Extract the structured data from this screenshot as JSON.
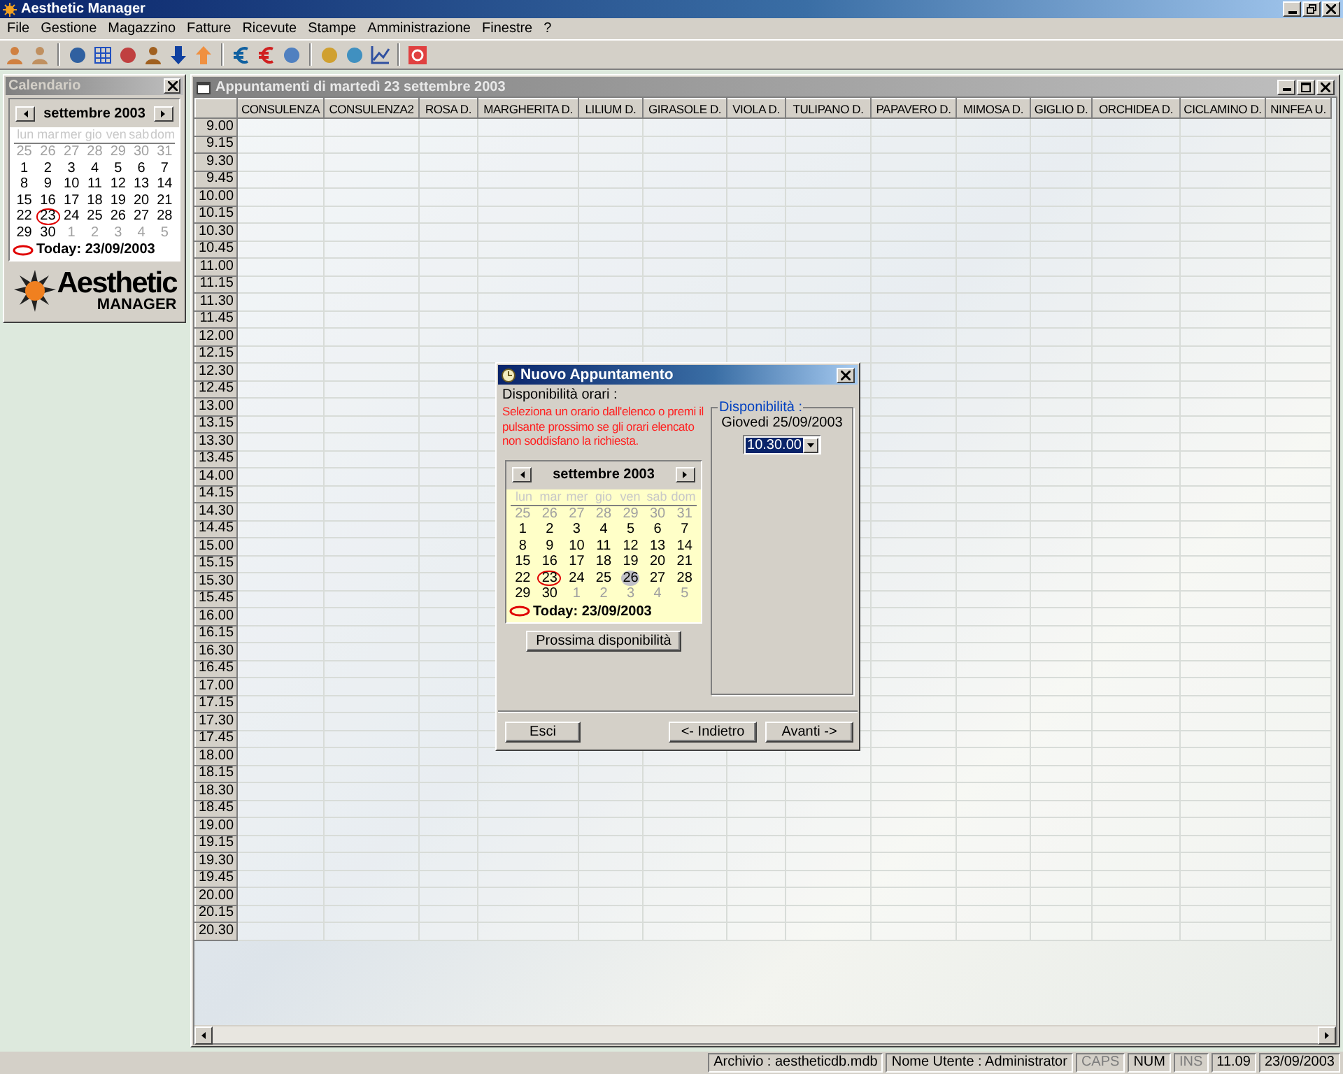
{
  "window": {
    "title": "Aesthetic Manager"
  },
  "menu": [
    "File",
    "Gestione",
    "Magazzino",
    "Fatture",
    "Ricevute",
    "Stampe",
    "Amministrazione",
    "Finestre",
    "?"
  ],
  "calendar_panel": {
    "title": "Calendario",
    "calendar": {
      "month": "settembre 2003",
      "weekdays": [
        "lun",
        "mar",
        "mer",
        "gio",
        "ven",
        "sab",
        "dom"
      ],
      "weeks": [
        [
          {
            "label": "25",
            "kind": "other"
          },
          {
            "label": "26",
            "kind": "other"
          },
          {
            "label": "27",
            "kind": "other"
          },
          {
            "label": "28",
            "kind": "other"
          },
          {
            "label": "29",
            "kind": "other"
          },
          {
            "label": "30",
            "kind": "other"
          },
          {
            "label": "31",
            "kind": "other"
          }
        ],
        [
          {
            "label": "1",
            "kind": "day"
          },
          {
            "label": "2",
            "kind": "day"
          },
          {
            "label": "3",
            "kind": "day"
          },
          {
            "label": "4",
            "kind": "day"
          },
          {
            "label": "5",
            "kind": "day"
          },
          {
            "label": "6",
            "kind": "day"
          },
          {
            "label": "7",
            "kind": "day"
          }
        ],
        [
          {
            "label": "8",
            "kind": "day"
          },
          {
            "label": "9",
            "kind": "day"
          },
          {
            "label": "10",
            "kind": "day"
          },
          {
            "label": "11",
            "kind": "day"
          },
          {
            "label": "12",
            "kind": "day"
          },
          {
            "label": "13",
            "kind": "day"
          },
          {
            "label": "14",
            "kind": "day"
          }
        ],
        [
          {
            "label": "15",
            "kind": "day"
          },
          {
            "label": "16",
            "kind": "day"
          },
          {
            "label": "17",
            "kind": "day"
          },
          {
            "label": "18",
            "kind": "day"
          },
          {
            "label": "19",
            "kind": "day"
          },
          {
            "label": "20",
            "kind": "day"
          },
          {
            "label": "21",
            "kind": "day"
          }
        ],
        [
          {
            "label": "22",
            "kind": "day"
          },
          {
            "label": "23",
            "kind": "today"
          },
          {
            "label": "24",
            "kind": "day"
          },
          {
            "label": "25",
            "kind": "day"
          },
          {
            "label": "26",
            "kind": "day"
          },
          {
            "label": "27",
            "kind": "day"
          },
          {
            "label": "28",
            "kind": "day"
          }
        ],
        [
          {
            "label": "29",
            "kind": "day"
          },
          {
            "label": "30",
            "kind": "day"
          },
          {
            "label": "1",
            "kind": "other"
          },
          {
            "label": "2",
            "kind": "other"
          },
          {
            "label": "3",
            "kind": "other"
          },
          {
            "label": "4",
            "kind": "other"
          },
          {
            "label": "5",
            "kind": "other"
          }
        ]
      ],
      "today": "Today: 23/09/2003"
    },
    "logo": {
      "title": "Aesthetic",
      "subtitle": "MANAGER"
    }
  },
  "appointments": {
    "title": "Appuntamenti di martedì 23 settembre 2003",
    "columns": [
      "CONSULENZA",
      "CONSULENZA2",
      "ROSA D.",
      "MARGHERITA D.",
      "LILIUM D.",
      "GIRASOLE D.",
      "VIOLA D.",
      "TULIPANO D.",
      "PAPAVERO D.",
      "MIMOSA D.",
      "GIGLIO D.",
      "ORCHIDEA D.",
      "CICLAMINO D.",
      "NINFEA U."
    ],
    "times": [
      "9.00",
      "9.15",
      "9.30",
      "9.45",
      "10.00",
      "10.15",
      "10.30",
      "10.45",
      "11.00",
      "11.15",
      "11.30",
      "11.45",
      "12.00",
      "12.15",
      "12.30",
      "12.45",
      "13.00",
      "13.15",
      "13.30",
      "13.45",
      "14.00",
      "14.15",
      "14.30",
      "14.45",
      "15.00",
      "15.15",
      "15.30",
      "15.45",
      "16.00",
      "16.15",
      "16.30",
      "16.45",
      "17.00",
      "17.15",
      "17.30",
      "17.45",
      "18.00",
      "18.15",
      "18.30",
      "18.45",
      "19.00",
      "19.15",
      "19.30",
      "19.45",
      "20.00",
      "20.15",
      "20.30"
    ]
  },
  "dialog": {
    "title": "Nuovo Appuntamento",
    "left_group": "Disponibilità orari :",
    "instructions": "Seleziona un orario dall'elenco o premi il pulsante prossimo se gli orari elencato non soddisfano la richiesta.",
    "calendar": {
      "month": "settembre 2003",
      "weekdays": [
        "lun",
        "mar",
        "mer",
        "gio",
        "ven",
        "sab",
        "dom"
      ],
      "weeks": [
        [
          {
            "label": "25",
            "kind": "other"
          },
          {
            "label": "26",
            "kind": "other"
          },
          {
            "label": "27",
            "kind": "other"
          },
          {
            "label": "28",
            "kind": "other"
          },
          {
            "label": "29",
            "kind": "other"
          },
          {
            "label": "30",
            "kind": "other"
          },
          {
            "label": "31",
            "kind": "other"
          }
        ],
        [
          {
            "label": "1",
            "kind": "day"
          },
          {
            "label": "2",
            "kind": "day"
          },
          {
            "label": "3",
            "kind": "day"
          },
          {
            "label": "4",
            "kind": "day"
          },
          {
            "label": "5",
            "kind": "day"
          },
          {
            "label": "6",
            "kind": "day"
          },
          {
            "label": "7",
            "kind": "day"
          }
        ],
        [
          {
            "label": "8",
            "kind": "day"
          },
          {
            "label": "9",
            "kind": "day"
          },
          {
            "label": "10",
            "kind": "day"
          },
          {
            "label": "11",
            "kind": "day"
          },
          {
            "label": "12",
            "kind": "day"
          },
          {
            "label": "13",
            "kind": "day"
          },
          {
            "label": "14",
            "kind": "day"
          }
        ],
        [
          {
            "label": "15",
            "kind": "day"
          },
          {
            "label": "16",
            "kind": "day"
          },
          {
            "label": "17",
            "kind": "day"
          },
          {
            "label": "18",
            "kind": "day"
          },
          {
            "label": "19",
            "kind": "day"
          },
          {
            "label": "20",
            "kind": "day"
          },
          {
            "label": "21",
            "kind": "day"
          }
        ],
        [
          {
            "label": "22",
            "kind": "day"
          },
          {
            "label": "23",
            "kind": "today"
          },
          {
            "label": "24",
            "kind": "day"
          },
          {
            "label": "25",
            "kind": "day"
          },
          {
            "label": "26",
            "kind": "selected"
          },
          {
            "label": "27",
            "kind": "day"
          },
          {
            "label": "28",
            "kind": "day"
          }
        ],
        [
          {
            "label": "29",
            "kind": "day"
          },
          {
            "label": "30",
            "kind": "day"
          },
          {
            "label": "1",
            "kind": "other"
          },
          {
            "label": "2",
            "kind": "other"
          },
          {
            "label": "3",
            "kind": "other"
          },
          {
            "label": "4",
            "kind": "other"
          },
          {
            "label": "5",
            "kind": "other"
          }
        ]
      ],
      "today": "Today: 23/09/2003"
    },
    "next_button": "Prossima disponibilità",
    "right_group": "Disponibilità :",
    "date": "Giovedi 25/09/2003",
    "time_value": "10.30.00",
    "buttons": [
      "Esci",
      "<- Indietro",
      "Avanti ->"
    ]
  },
  "status_bar": [
    {
      "text": "Archivio : aestheticdb.mdb",
      "disabled": false
    },
    {
      "text": "Nome Utente : Administrator",
      "disabled": false
    },
    {
      "text": "CAPS",
      "disabled": true
    },
    {
      "text": "NUM",
      "disabled": false
    },
    {
      "text": "INS",
      "disabled": true
    },
    {
      "text": "11.09",
      "disabled": false
    },
    {
      "text": "23/09/2003",
      "disabled": false
    }
  ]
}
